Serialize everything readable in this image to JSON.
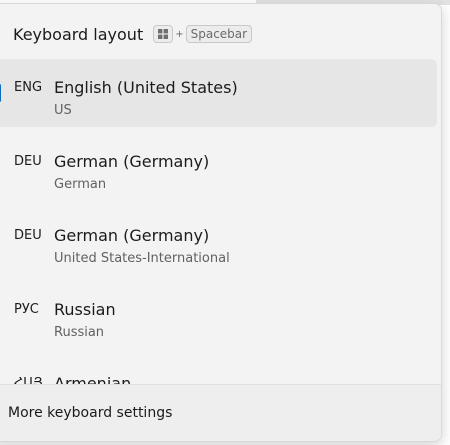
{
  "flyout": {
    "title": "Keyboard layout",
    "shortcut": {
      "plus": "+",
      "key": "Spacebar"
    }
  },
  "layouts": [
    {
      "code": "ENG",
      "name": "English (United States)",
      "layout": "US",
      "selected": true
    },
    {
      "code": "DEU",
      "name": "German (Germany)",
      "layout": "German",
      "selected": false
    },
    {
      "code": "DEU",
      "name": "German (Germany)",
      "layout": "United States-International",
      "selected": false
    },
    {
      "code": "РУС",
      "name": "Russian",
      "layout": "Russian",
      "selected": false
    },
    {
      "code": "ՀԱՅ",
      "name": "Armenian",
      "layout": "",
      "selected": false
    }
  ],
  "footer": {
    "link_label": "More keyboard settings"
  },
  "colors": {
    "accent": "#0f6cbd",
    "flyout_bg": "#f3f3f3",
    "selected_bg": "#e6e6e6"
  }
}
